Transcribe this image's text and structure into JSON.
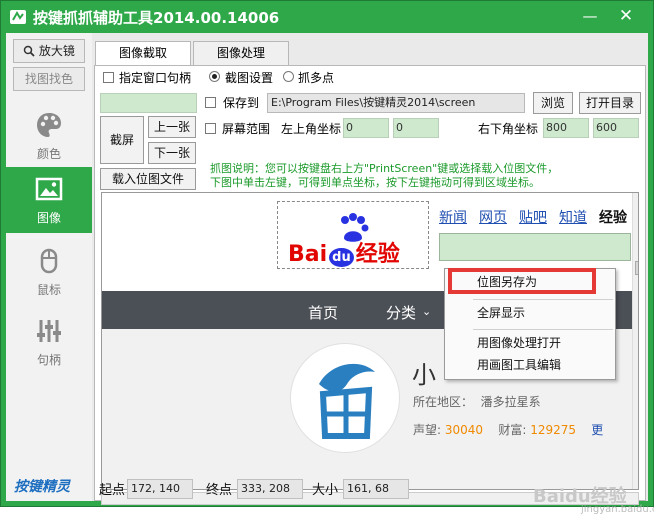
{
  "window": {
    "title": "按键抓抓辅助工具2014.00.14006",
    "minimize": "—",
    "close": "✕"
  },
  "sidebar": {
    "zoom_button": "放大镜",
    "find_button": "找图找色",
    "items": [
      {
        "label": "颜色",
        "icon": "palette-icon"
      },
      {
        "label": "图像",
        "icon": "image-icon"
      },
      {
        "label": "鼠标",
        "icon": "mouse-icon"
      },
      {
        "label": "句柄",
        "icon": "sliders-icon"
      }
    ],
    "active_index": 1,
    "brand": "按键精灵"
  },
  "tabs": [
    "图像截取",
    "图像处理"
  ],
  "capture": {
    "specify_window": "指定窗口句柄",
    "radio_screenshot": "截图设置",
    "radio_multipoint": "抓多点",
    "save_to_label": "保存到",
    "save_path": "E:\\Program Files\\按键精灵2014\\screen",
    "browse": "浏览",
    "open_dir": "打开目录",
    "screen_button": "截屏",
    "prev_button": "上一张",
    "next_button": "下一张",
    "load_button": "载入位图文件",
    "screen_range": "屏幕范围",
    "top_left_label": "左上角坐标",
    "top_left_x": "0",
    "top_left_y": "0",
    "bottom_right_label": "右下角坐标",
    "bottom_right_x": "800",
    "bottom_right_y": "600",
    "note_line1": "抓图说明：您可以按键盘右上方\"PrintScreen\"键或选择载入位图文件，",
    "note_line2": "下图中单击左键，可得到单点坐标，按下左键拖动可得到区域坐标。"
  },
  "preview": {
    "logo_text": "Bai",
    "logo_du": "du",
    "logo_suffix": "经验",
    "links": [
      "新闻",
      "网页",
      "贴吧",
      "知道",
      "经验"
    ],
    "nav_home": "首页",
    "nav_category": "分类",
    "profile_name": "小",
    "location_label": "所在地区：",
    "location_value": "潘多拉星系",
    "fame_label": "声望:",
    "fame_value": "30040",
    "wealth_label": "财富:",
    "wealth_value": "129275",
    "more": "更",
    "watermark": "Baidu经验",
    "watermark_url": "jingyan.baidu.com"
  },
  "context_menu": {
    "items": [
      "位图另存为",
      "全屏显示",
      "用图像处理打开",
      "用画图工具编辑"
    ]
  },
  "status": {
    "start_label": "起点",
    "start_value": "172, 140",
    "end_label": "终点",
    "end_value": "333, 208",
    "size_label": "大小",
    "size_value": "161, 68"
  },
  "colors": {
    "accent": "#2fa84a",
    "note": "#1a9a2a",
    "field": "#cfe9cf",
    "highlight": "#e53935",
    "baidu_red": "#e10602",
    "baidu_blue": "#2932e1"
  }
}
